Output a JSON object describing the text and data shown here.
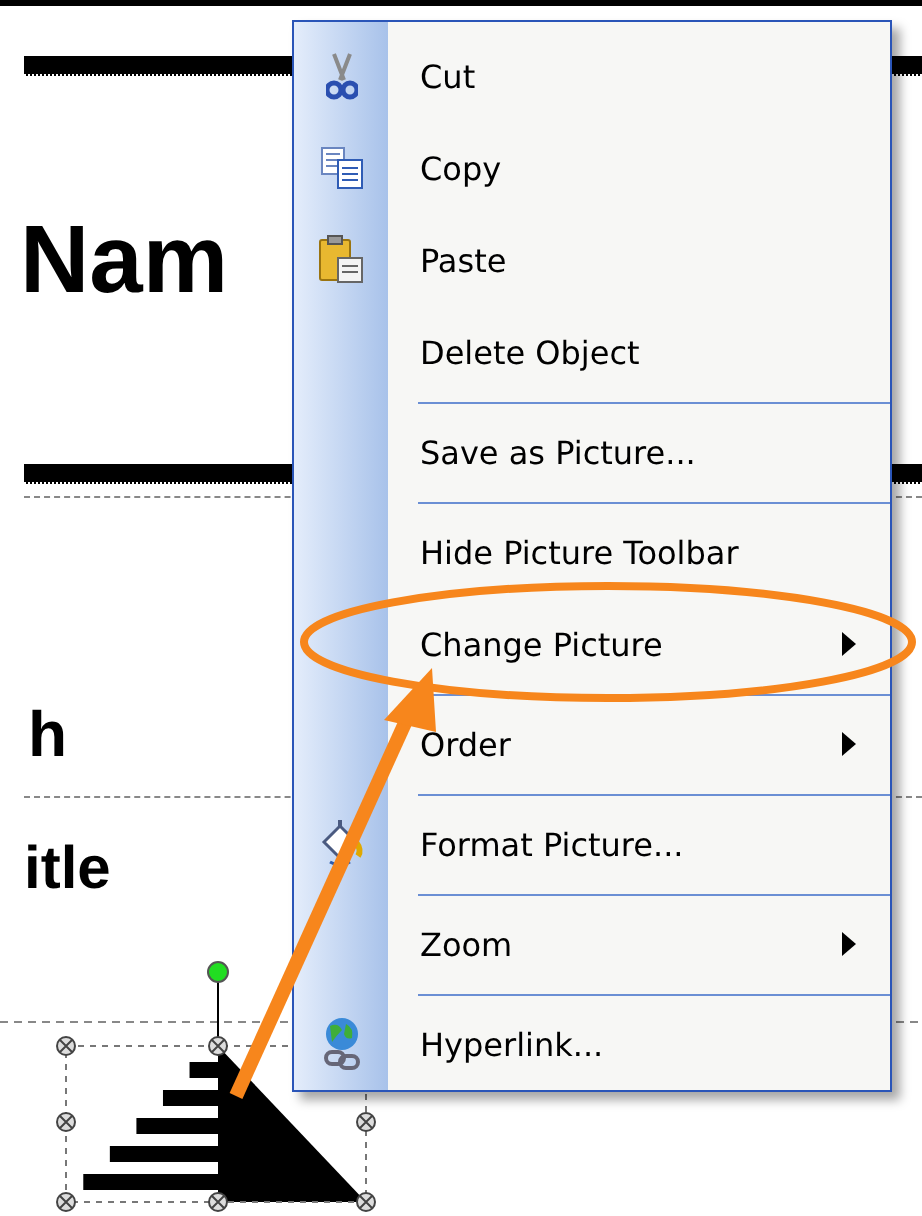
{
  "document": {
    "heading": "Nam",
    "subheading": "h",
    "subtitle": "itle"
  },
  "context_menu": {
    "items": [
      {
        "label": "Cut",
        "divider_above": false,
        "submenu": false
      },
      {
        "label": "Copy",
        "divider_above": false,
        "submenu": false
      },
      {
        "label": "Paste",
        "divider_above": false,
        "submenu": false
      },
      {
        "label": "Delete Object",
        "divider_above": false,
        "submenu": false
      },
      {
        "label": "Save as Picture...",
        "divider_above": true,
        "submenu": false
      },
      {
        "label": "Hide Picture Toolbar",
        "divider_above": true,
        "submenu": false
      },
      {
        "label": "Change Picture",
        "divider_above": false,
        "submenu": true
      },
      {
        "label": "Order",
        "divider_above": true,
        "submenu": true
      },
      {
        "label": "Format Picture...",
        "divider_above": true,
        "submenu": false
      },
      {
        "label": "Zoom",
        "divider_above": true,
        "submenu": true
      },
      {
        "label": "Hyperlink...",
        "divider_above": true,
        "submenu": false
      }
    ]
  }
}
